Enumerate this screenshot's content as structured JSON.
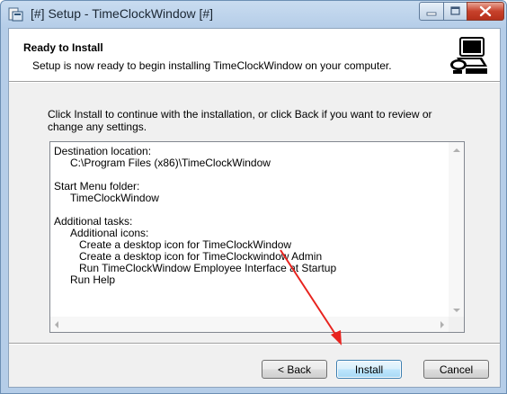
{
  "window": {
    "title": "[#] Setup - TimeClockWindow [#]",
    "controls": {
      "minimize": "minimize",
      "maximize": "maximize",
      "close": "close"
    }
  },
  "header": {
    "title": "Ready to Install",
    "subtitle": "Setup is now ready to begin installing TimeClockWindow on your computer."
  },
  "intro": {
    "line1": "Click Install to continue with the installation, or click Back if you want to review or",
    "line2": "change any settings."
  },
  "memo": {
    "lines": [
      {
        "text": "Destination location:",
        "indent": 0
      },
      {
        "text": "C:\\Program Files (x86)\\TimeClockWindow",
        "indent": 1
      },
      {
        "text": "",
        "indent": 0
      },
      {
        "text": "Start Menu folder:",
        "indent": 0
      },
      {
        "text": "TimeClockWindow",
        "indent": 1
      },
      {
        "text": "",
        "indent": 0
      },
      {
        "text": "Additional tasks:",
        "indent": 0
      },
      {
        "text": "Additional icons:",
        "indent": 1
      },
      {
        "text": "Create a desktop icon for TimeClockWindow",
        "indent": 2
      },
      {
        "text": "Create a desktop icon for TimeClockwindow Admin",
        "indent": 2
      },
      {
        "text": "Run TimeClockWindow Employee Interface at Startup",
        "indent": 2
      },
      {
        "text": "Run Help",
        "indent": 1
      }
    ]
  },
  "buttons": {
    "back": "< Back",
    "install": "Install",
    "cancel": "Cancel"
  },
  "colors": {
    "annotation_arrow": "#e8231e",
    "title_bar": "#b5cde8",
    "close_button": "#c7412b"
  }
}
